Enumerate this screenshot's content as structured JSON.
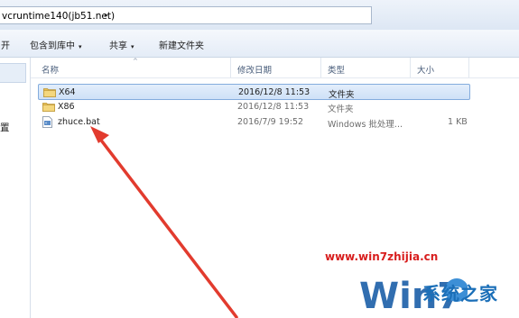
{
  "address": {
    "path": "vcruntime140(jb51.net)",
    "arrow": "▸"
  },
  "toolbar": {
    "left_label": "开",
    "include_label": "包含到库中",
    "share_label": "共享",
    "new_folder_label": "新建文件夹",
    "caret": "▾"
  },
  "navpane": {
    "partial_label": "置"
  },
  "columns": {
    "name": "名称",
    "modified": "修改日期",
    "type": "类型",
    "size": "大小",
    "sort_indicator": "^"
  },
  "files": [
    {
      "name": "X64",
      "modified": "2016/12/8 11:53",
      "type": "文件夹",
      "size": "",
      "icon": "folder-icon",
      "selected": true
    },
    {
      "name": "X86",
      "modified": "2016/12/8 11:53",
      "type": "文件夹",
      "size": "",
      "icon": "folder-icon",
      "selected": false
    },
    {
      "name": "zhuce.bat",
      "modified": "2016/7/9 19:52",
      "type": "Windows 批处理...",
      "size": "1 KB",
      "icon": "batch-file-icon",
      "selected": false
    }
  ],
  "watermark": {
    "url": "www.win7zhijia.cn",
    "brand": "系统之家",
    "logo_text": "Win7"
  },
  "colors": {
    "selection": "#cfe1f7",
    "arrow": "#e23b2e",
    "watermark_url": "#d81e1e",
    "watermark_brand": "#1b6fb8"
  }
}
